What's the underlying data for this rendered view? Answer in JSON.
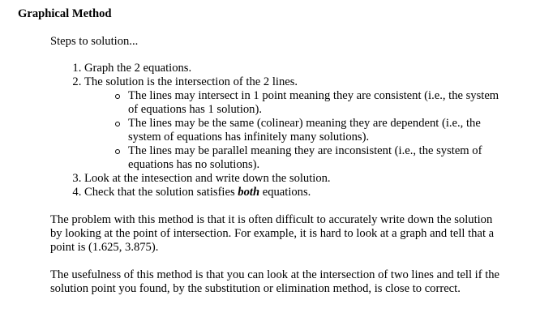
{
  "title": "Graphical Method",
  "intro": "Steps to solution...",
  "steps": [
    "Graph the 2 equations.",
    "The solution is the intersection of the 2 lines.",
    "Look at the intesection and write down the solution.",
    "Check that the solution satisfies"
  ],
  "step4_emphasis": "both",
  "step4_tail": " equations.",
  "sub_items": [
    "The lines may intersect in 1 point meaning they are consistent (i.e., the system of equations has 1 solution).",
    "The lines may be the same (colinear) meaning they are dependent (i.e., the system of equations has infinitely many solutions).",
    "The lines may be parallel meaning they are inconsistent (i.e., the system of equations has no solutions)."
  ],
  "paragraphs": [
    "The problem with this method is that it is often difficult to accurately write down the solution by looking at the point of intersection. For example, it is hard to look at a graph and tell that a point is (1.625, 3.875).",
    "The usefulness of this method is that you can look at the intersection of two lines and tell if the solution point you found, by the substitution or elimination method, is close to correct."
  ]
}
